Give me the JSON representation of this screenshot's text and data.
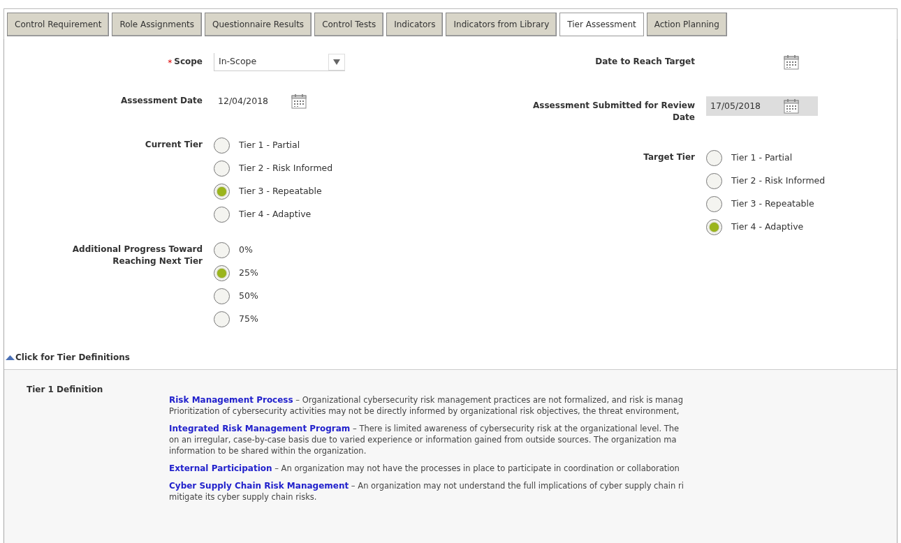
{
  "tabs": [
    {
      "label": "Control Requirement",
      "selected": false
    },
    {
      "label": "Role Assignments",
      "selected": false
    },
    {
      "label": "Questionnaire Results",
      "selected": false
    },
    {
      "label": "Control Tests",
      "selected": false
    },
    {
      "label": "Indicators",
      "selected": false
    },
    {
      "label": "Indicators from Library",
      "selected": false
    },
    {
      "label": "Tier Assessment",
      "selected": true
    },
    {
      "label": "Action Planning",
      "selected": false
    }
  ],
  "form": {
    "left": [
      {
        "kind": "select",
        "label": "Scope",
        "required_mark": "*",
        "value": "In-Scope"
      },
      {
        "kind": "date",
        "label": "Assessment Date",
        "value": "12/04/2018",
        "disabled": false
      },
      {
        "kind": "radio",
        "label": "Current Tier",
        "options": [
          {
            "label": "Tier 1 - Partial",
            "selected": false
          },
          {
            "label": "Tier 2 - Risk Informed",
            "selected": false
          },
          {
            "label": "Tier 3 - Repeatable",
            "selected": true
          },
          {
            "label": "Tier 4 - Adaptive",
            "selected": false
          }
        ]
      },
      {
        "kind": "radio",
        "label": "Additional Progress Toward Reaching Next Tier",
        "options": [
          {
            "label": "0%",
            "selected": false
          },
          {
            "label": "25%",
            "selected": true
          },
          {
            "label": "50%",
            "selected": false
          },
          {
            "label": "75%",
            "selected": false
          }
        ]
      }
    ],
    "right": [
      {
        "kind": "date",
        "label": "Date to Reach Target"
      },
      {
        "kind": "date",
        "label": "Assessment Submitted for Review Date",
        "value": "17/05/2018",
        "disabled": true
      },
      {
        "kind": "radio",
        "label": "Target Tier",
        "options": [
          {
            "label": "Tier 1 - Partial",
            "selected": false
          },
          {
            "label": "Tier 2 - Risk Informed",
            "selected": false
          },
          {
            "label": "Tier 3 - Repeatable",
            "selected": false
          },
          {
            "label": "Tier 4 - Adaptive",
            "selected": true
          }
        ]
      }
    ]
  },
  "tier_definitions": {
    "toggle": "Click for Tier Definitions",
    "expanded": true,
    "label": "Tier 1 Definition",
    "items": [
      {
        "term": "Risk Management Process",
        "lines": [
          " – Organizational cybersecurity risk management practices are not formalized, and risk is manag",
          "Prioritization of cybersecurity activities may not be directly informed by organizational risk objectives, the threat environment,"
        ]
      },
      {
        "term": "Integrated Risk Management Program",
        "lines": [
          " – There is limited awareness of cybersecurity risk at the organizational level. The",
          "on an irregular, case-by-case basis due to varied experience or information gained from outside sources. The organization ma",
          "information to be shared within the organization."
        ]
      },
      {
        "term": "External Participation",
        "lines": [
          " – An organization may not have the processes in place to participate in coordination or collaboration"
        ]
      },
      {
        "term": "Cyber Supply Chain Risk Management",
        "lines": [
          " – An organization may not understand the full implications of cyber supply chain ri",
          "mitigate its cyber supply chain risks."
        ]
      }
    ]
  }
}
